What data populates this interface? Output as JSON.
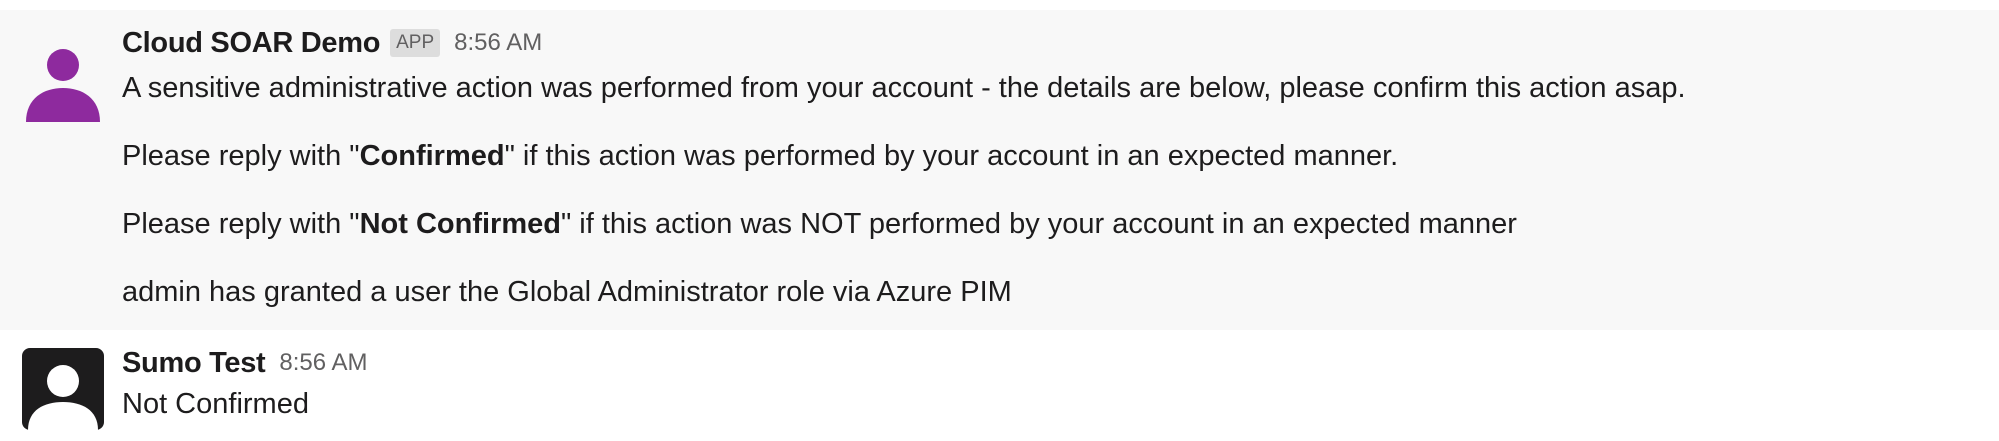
{
  "messages": [
    {
      "sender": "Cloud SOAR Demo",
      "badge": "APP",
      "time": "8:56 AM",
      "avatar_color": "#8e2a9e",
      "line1": "A sensitive administrative action was performed from your account - the details are below, please confirm this action asap.",
      "line2": {
        "prefix": "Please reply with \"",
        "bold": "Confirmed",
        "suffix": "\" if this action was performed by your account in an expected manner."
      },
      "line3": {
        "prefix": "Please reply with \"",
        "bold": "Not Confirmed",
        "suffix": "\" if this action was NOT performed by your account in an expected manner"
      },
      "line4": "admin has granted a user the Global Administrator role via Azure PIM"
    },
    {
      "sender": "Sumo Test",
      "time": "8:56 AM",
      "avatar_color": "#1d1c1d",
      "line1": "Not Confirmed"
    }
  ],
  "icons": {
    "bot_avatar": "user-silhouette-icon",
    "user_avatar": "user-silhouette-icon"
  }
}
